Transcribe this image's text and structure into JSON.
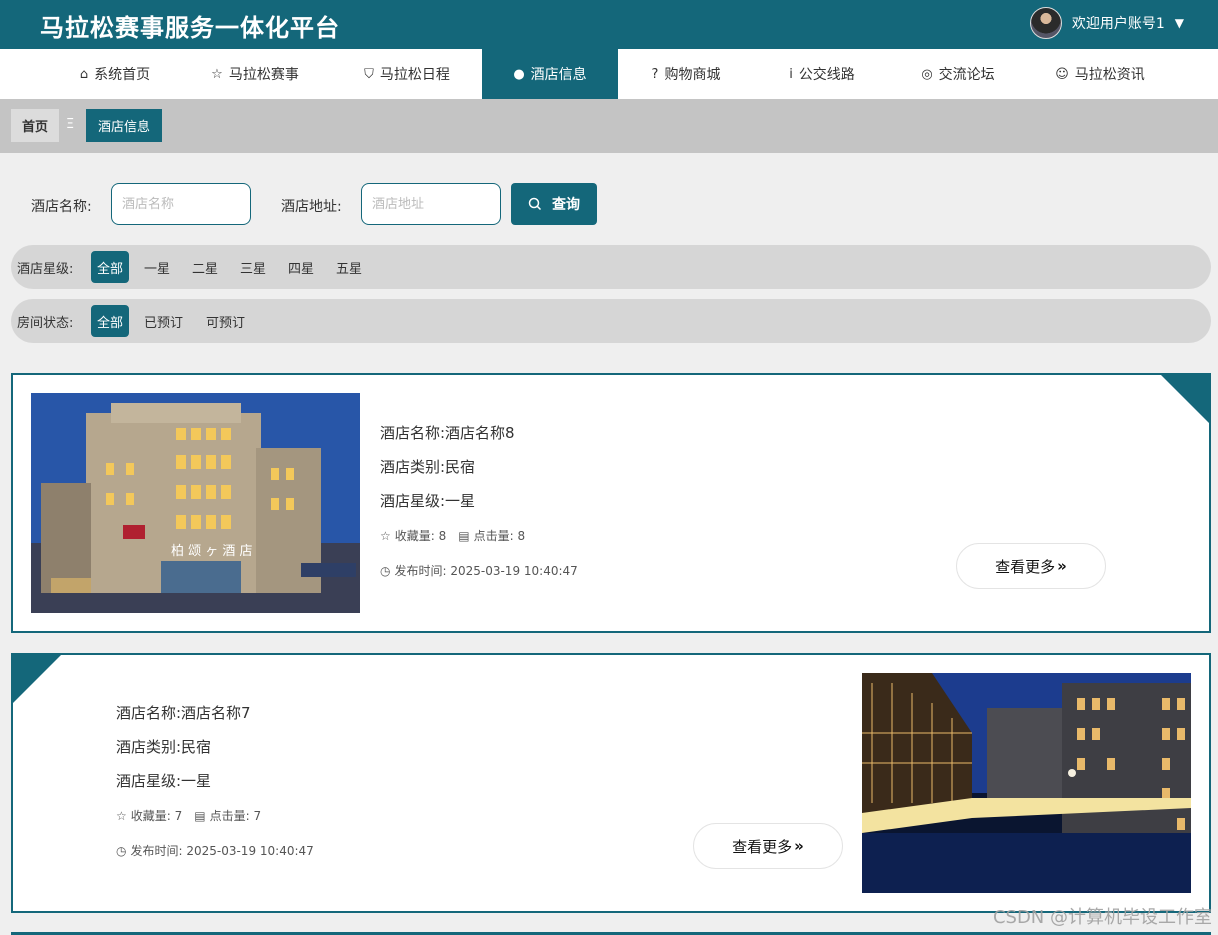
{
  "header": {
    "site_title": "马拉松赛事服务一体化平台",
    "welcome": "欢迎用户账号1",
    "caret": "▼"
  },
  "nav": {
    "items": [
      {
        "label": "系统首页",
        "icon": "⌂",
        "icon_name": "home-icon"
      },
      {
        "label": "马拉松赛事",
        "icon": "☆",
        "icon_name": "star-icon"
      },
      {
        "label": "马拉松日程",
        "icon": "⛉",
        "icon_name": "bag-icon"
      },
      {
        "label": "酒店信息",
        "icon": "●",
        "icon_name": "alert-circle-icon"
      },
      {
        "label": "购物商城",
        "icon": "?",
        "icon_name": "question-circle-icon"
      },
      {
        "label": "公交线路",
        "icon": "i",
        "icon_name": "info-circle-icon"
      },
      {
        "label": "交流论坛",
        "icon": "◎",
        "icon_name": "target-icon"
      },
      {
        "label": "马拉松资讯",
        "icon": "☺",
        "icon_name": "smile-icon"
      }
    ],
    "active_index": 3
  },
  "breadcrumb": {
    "home": "首页",
    "separator": "Ξ",
    "current": "酒店信息"
  },
  "search": {
    "name_label": "酒店名称:",
    "name_placeholder": "酒店名称",
    "address_label": "酒店地址:",
    "address_placeholder": "酒店地址",
    "button_label": "查询"
  },
  "filters": {
    "star": {
      "label": "酒店星级:",
      "options": [
        "全部",
        "一星",
        "二星",
        "三星",
        "四星",
        "五星"
      ],
      "selected": "全部"
    },
    "room": {
      "label": "房间状态:",
      "options": [
        "全部",
        "已预订",
        "可预订"
      ],
      "selected": "全部"
    }
  },
  "hotels": [
    {
      "name_line": "酒店名称:酒店名称8",
      "type_line": "酒店类别:民宿",
      "star_line": "酒店星级:一星",
      "favorites": "收藏量:  8",
      "clicks": "点击量:  8",
      "published": "发布时间:  2025-03-19 10:40:47",
      "more": "查看更多",
      "sign_text": "柏 颂 ヶ 酒 店"
    },
    {
      "name_line": "酒店名称:酒店名称7",
      "type_line": "酒店类别:民宿",
      "star_line": "酒店星级:一星",
      "favorites": "收藏量:  7",
      "clicks": "点击量:  7",
      "published": "发布时间:  2025-03-19 10:40:47",
      "more": "查看更多"
    }
  ],
  "watermark": "CSDN @计算机毕设工作室",
  "colors": {
    "primary": "#14677a",
    "breadcrumb_bg": "#c4c4c4",
    "filter_bg": "#d6d6d6",
    "page_bg": "#efefef"
  }
}
